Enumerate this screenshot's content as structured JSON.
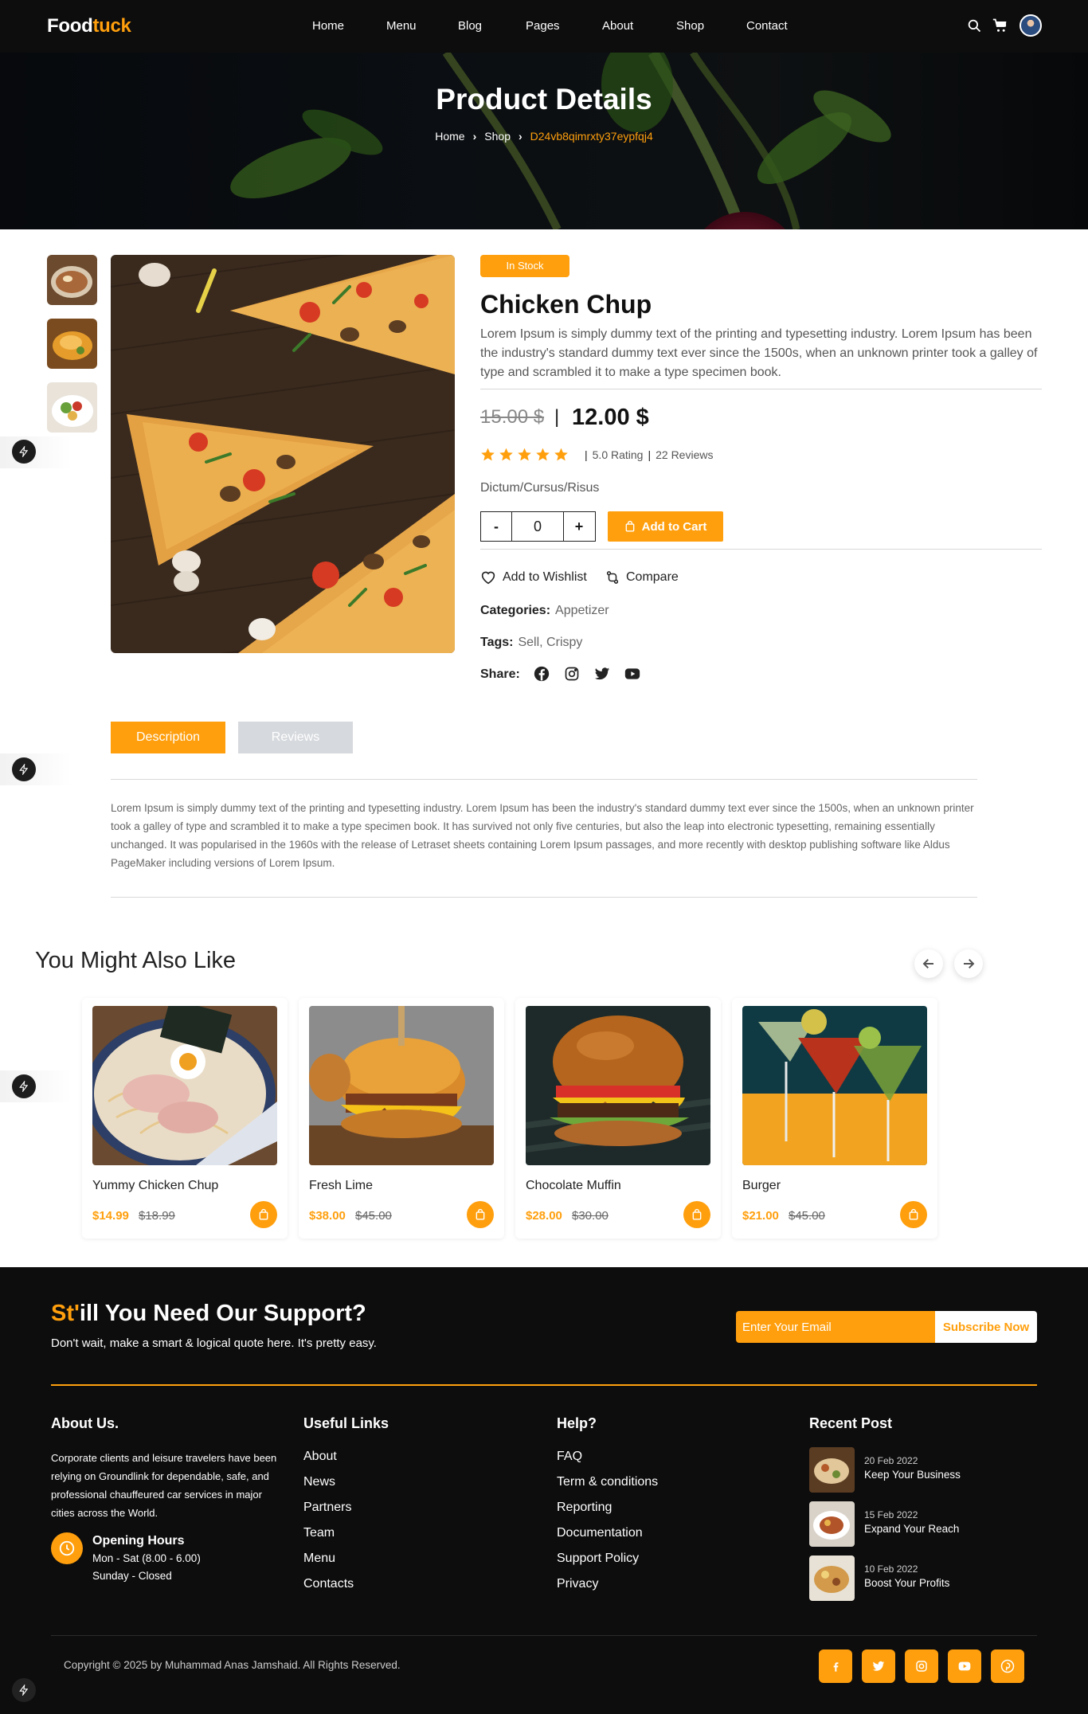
{
  "nav": {
    "logo_main": "Food",
    "logo_accent": "tuck",
    "links": [
      "Home",
      "Menu",
      "Blog",
      "Pages",
      "About",
      "Shop",
      "Contact"
    ],
    "icons": [
      "search-icon",
      "cart-icon",
      "avatar"
    ]
  },
  "hero": {
    "title": "Product Details",
    "breadcrumb": [
      "Home",
      "Shop",
      "D24vb8qimrxty37eypfqj4"
    ]
  },
  "product": {
    "stock": "In Stock",
    "name": "Chicken Chup",
    "description": "Lorem Ipsum is simply dummy text of the printing and typesetting industry. Lorem Ipsum has been the industry's standard dummy text ever since the 1500s, when an unknown printer took a galley of type and scrambled it to make a type specimen book.",
    "old_price": "15.00 $",
    "price_sep": "|",
    "price": "12.00 $",
    "rating_value": 5,
    "rating_text": "5.0 Rating",
    "reviews_text": "22 Reviews",
    "meta": "Dictum/Cursus/Risus",
    "quantity": "0",
    "qty_minus": "-",
    "qty_plus": "+",
    "add_to_cart": "Add to Cart",
    "wishlist": "Add to Wishlist",
    "compare": "Compare",
    "categories_label": "Categories:",
    "categories": "Appetizer",
    "tags_label": "Tags:",
    "tags": "Sell, Crispy",
    "share_label": "Share:",
    "share_icons": [
      "facebook-icon",
      "instagram-icon",
      "twitter-icon",
      "youtube-icon"
    ]
  },
  "tabs": {
    "description_label": "Description",
    "reviews_label": "Reviews",
    "active": "Description",
    "description_text": "Lorem Ipsum is simply dummy text of the printing and typesetting industry. Lorem Ipsum has been the industry's standard dummy text ever since the 1500s, when an unknown printer took a galley of type and scrambled it to make a type specimen book. It has survived not only five centuries, but also the leap into electronic typesetting, remaining essentially unchanged. It was popularised in the 1960s with the release of Letraset sheets containing Lorem Ipsum passages, and more recently with desktop publishing software like Aldus PageMaker including versions of Lorem Ipsum."
  },
  "related": {
    "title": "You Might Also Like",
    "items": [
      {
        "name": "Yummy Chicken Chup",
        "price": "$14.99",
        "old_price": "$18.99"
      },
      {
        "name": "Fresh Lime",
        "price": "$38.00",
        "old_price": "$45.00"
      },
      {
        "name": "Chocolate Muffin",
        "price": "$28.00",
        "old_price": "$30.00"
      },
      {
        "name": "Burger",
        "price": "$21.00",
        "old_price": "$45.00"
      }
    ]
  },
  "footer": {
    "support_accent": "St'",
    "support_title": "ill You Need Our Support?",
    "support_sub": "Don't wait, make a smart & logical quote here. It's pretty easy.",
    "email_placeholder": "Enter Your Email",
    "subscribe": "Subscribe Now",
    "about_title": "About Us.",
    "about_text": "Corporate clients and leisure travelers have been relying on Groundlink for dependable, safe, and professional chauffeured car services in major cities across the World.",
    "hours_title": "Opening Hours",
    "hours_line1": "Mon - Sat (8.00 - 6.00)",
    "hours_line2": "Sunday - Closed",
    "useful_title": "Useful Links",
    "useful_links": [
      "About",
      "News",
      "Partners",
      "Team",
      "Menu",
      "Contacts"
    ],
    "help_title": "Help?",
    "help_links": [
      "FAQ",
      "Term & conditions",
      "Reporting",
      "Documentation",
      "Support Policy",
      "Privacy"
    ],
    "recent_title": "Recent Post",
    "posts": [
      {
        "date": "20 Feb 2022",
        "title": "Keep Your Business"
      },
      {
        "date": "15 Feb 2022",
        "title": "Expand Your Reach"
      },
      {
        "date": "10 Feb 2022",
        "title": "Boost Your Profits"
      }
    ],
    "copyright": "Copyright © 2025 by Muhammad Anas Jamshaid. All Rights Reserved.",
    "social": [
      "facebook-icon",
      "twitter-icon",
      "instagram-icon",
      "youtube-icon",
      "pinterest-icon"
    ]
  },
  "colors": {
    "accent": "#ff9f0d",
    "dark": "#0d0d0d",
    "tab_inactive": "#d6d9dd"
  }
}
